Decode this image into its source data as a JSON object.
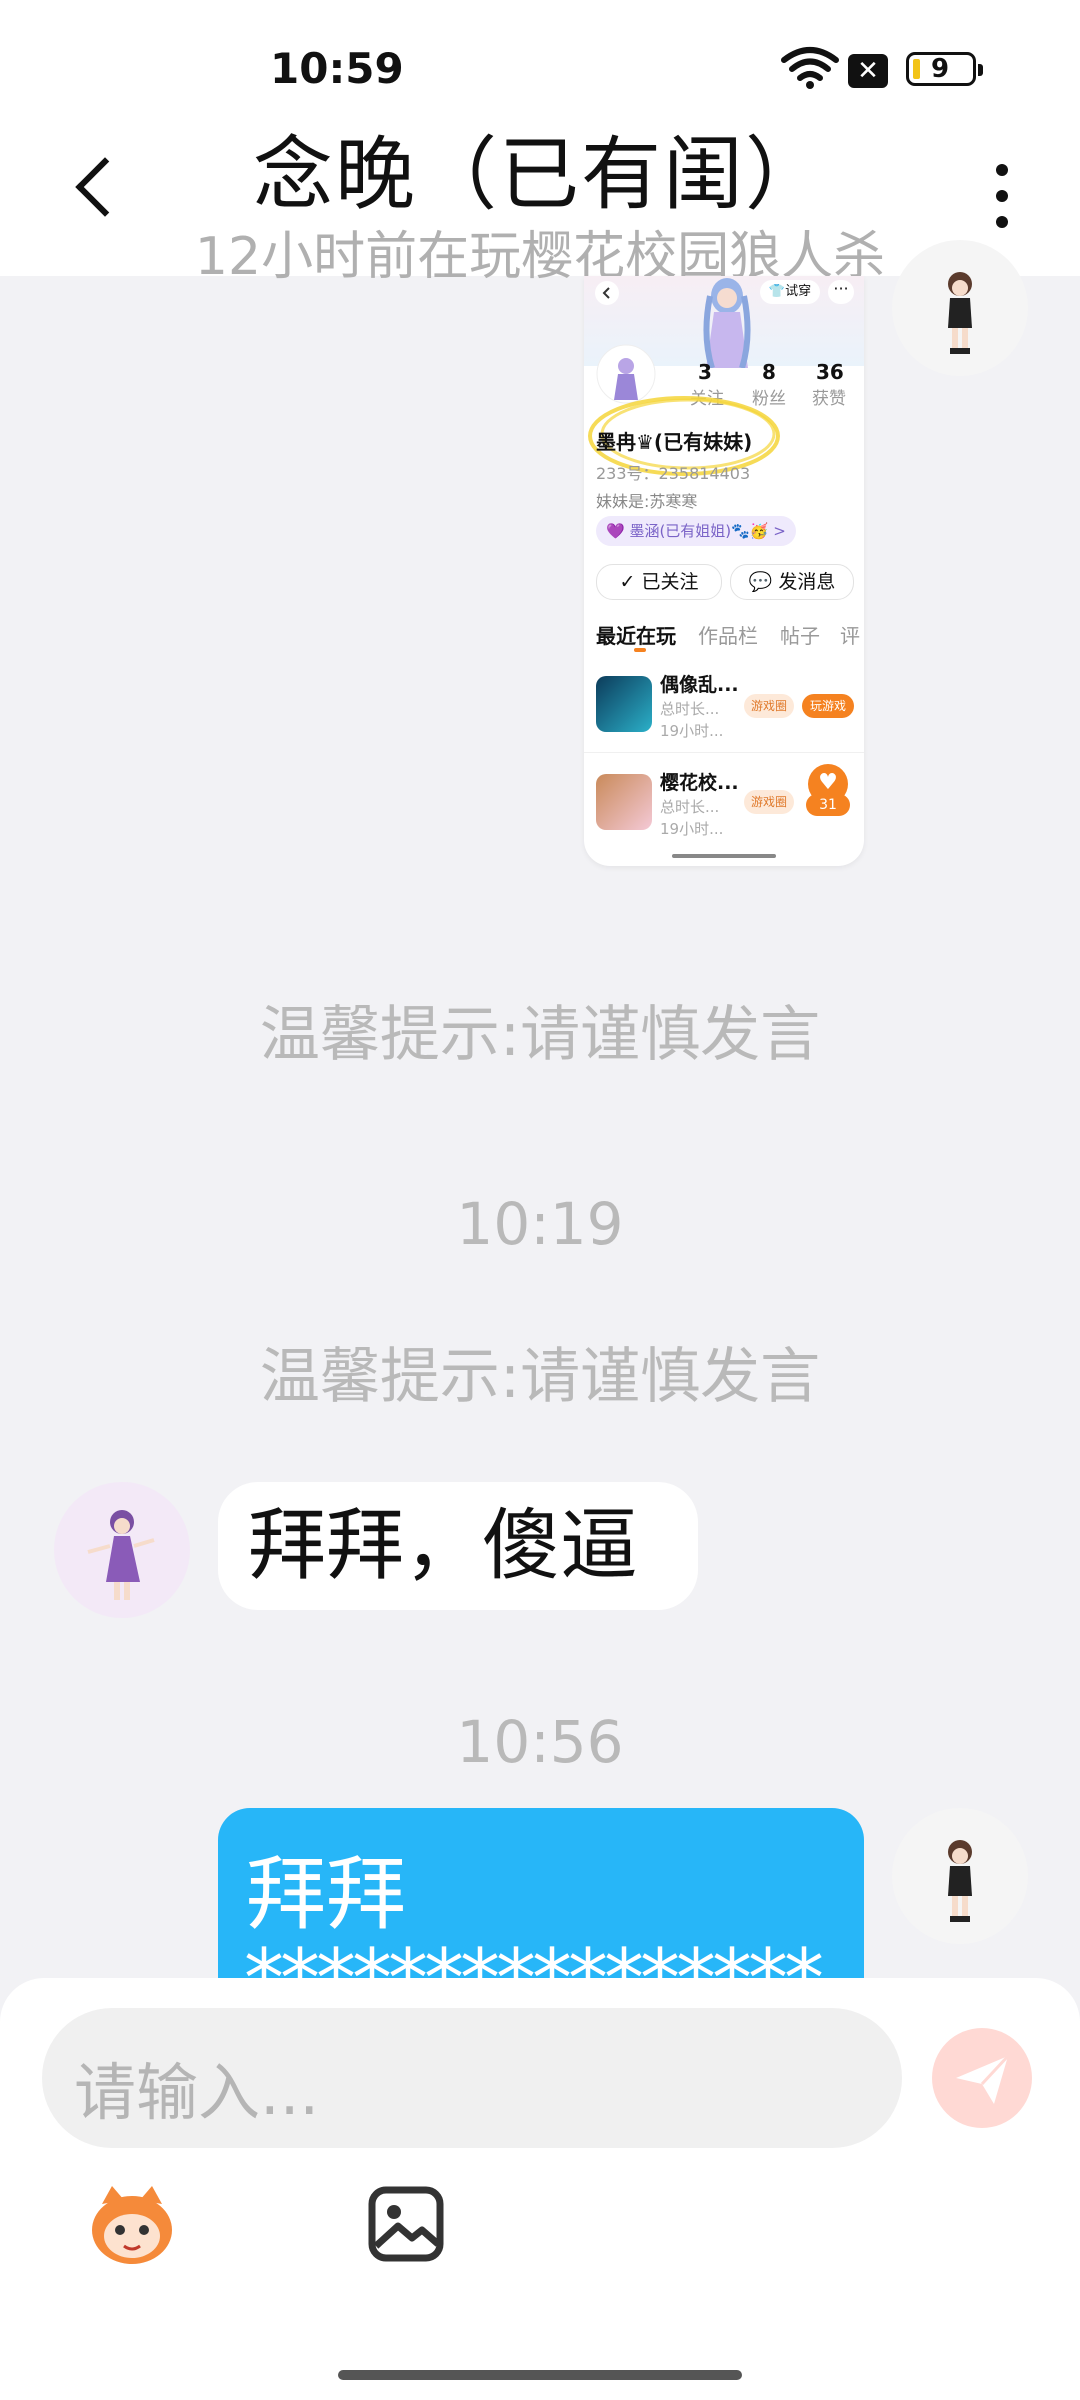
{
  "status_bar": {
    "time": "10:59",
    "battery": "9"
  },
  "header": {
    "title": "念晚（已有闺）",
    "subtitle": "12小时前在玩樱花校园狼人杀"
  },
  "shared_screenshot": {
    "trial_label": "试穿",
    "stats": [
      {
        "value": "3",
        "label": "关注"
      },
      {
        "value": "8",
        "label": "粉丝"
      },
      {
        "value": "36",
        "label": "获赞"
      }
    ],
    "name": "墨冉♛(已有妹妹)",
    "id_line": "233号：235814403",
    "sister_line": "妹妹是:苏寒寒",
    "relation_chip": "墨涵(已有姐姐)🐾🥳 >",
    "follow_button": "已关注",
    "message_button": "发消息",
    "tabs": [
      "最近在玩",
      "作品栏",
      "帖子",
      "评"
    ],
    "games": [
      {
        "name": "偶像乱...",
        "line1": "总时长...",
        "line2": "19小时...",
        "tag1": "游戏圈",
        "tag2": "玩游戏"
      },
      {
        "name": "樱花校...",
        "line1": "总时长...",
        "line2": "19小时...",
        "tag1": "游戏圈"
      }
    ],
    "like_count": "31"
  },
  "messages": {
    "notice1": "温馨提示:请谨慎发言",
    "time1": "10:19",
    "notice2": "温馨提示:请谨慎发言",
    "incoming": "拜拜，傻逼",
    "time2": "10:56",
    "outgoing_line1": "拜拜",
    "outgoing_line2": "****************"
  },
  "input": {
    "placeholder": "请输入..."
  },
  "colors": {
    "outgoing_bubble": "#27b6f8",
    "send_button": "#ffd9d4",
    "highlight": "#f5d53a"
  },
  "icons": [
    "back-icon",
    "more-icon",
    "wifi-icon",
    "battery-icon",
    "send-icon",
    "emoji-mascot-icon",
    "image-icon"
  ]
}
